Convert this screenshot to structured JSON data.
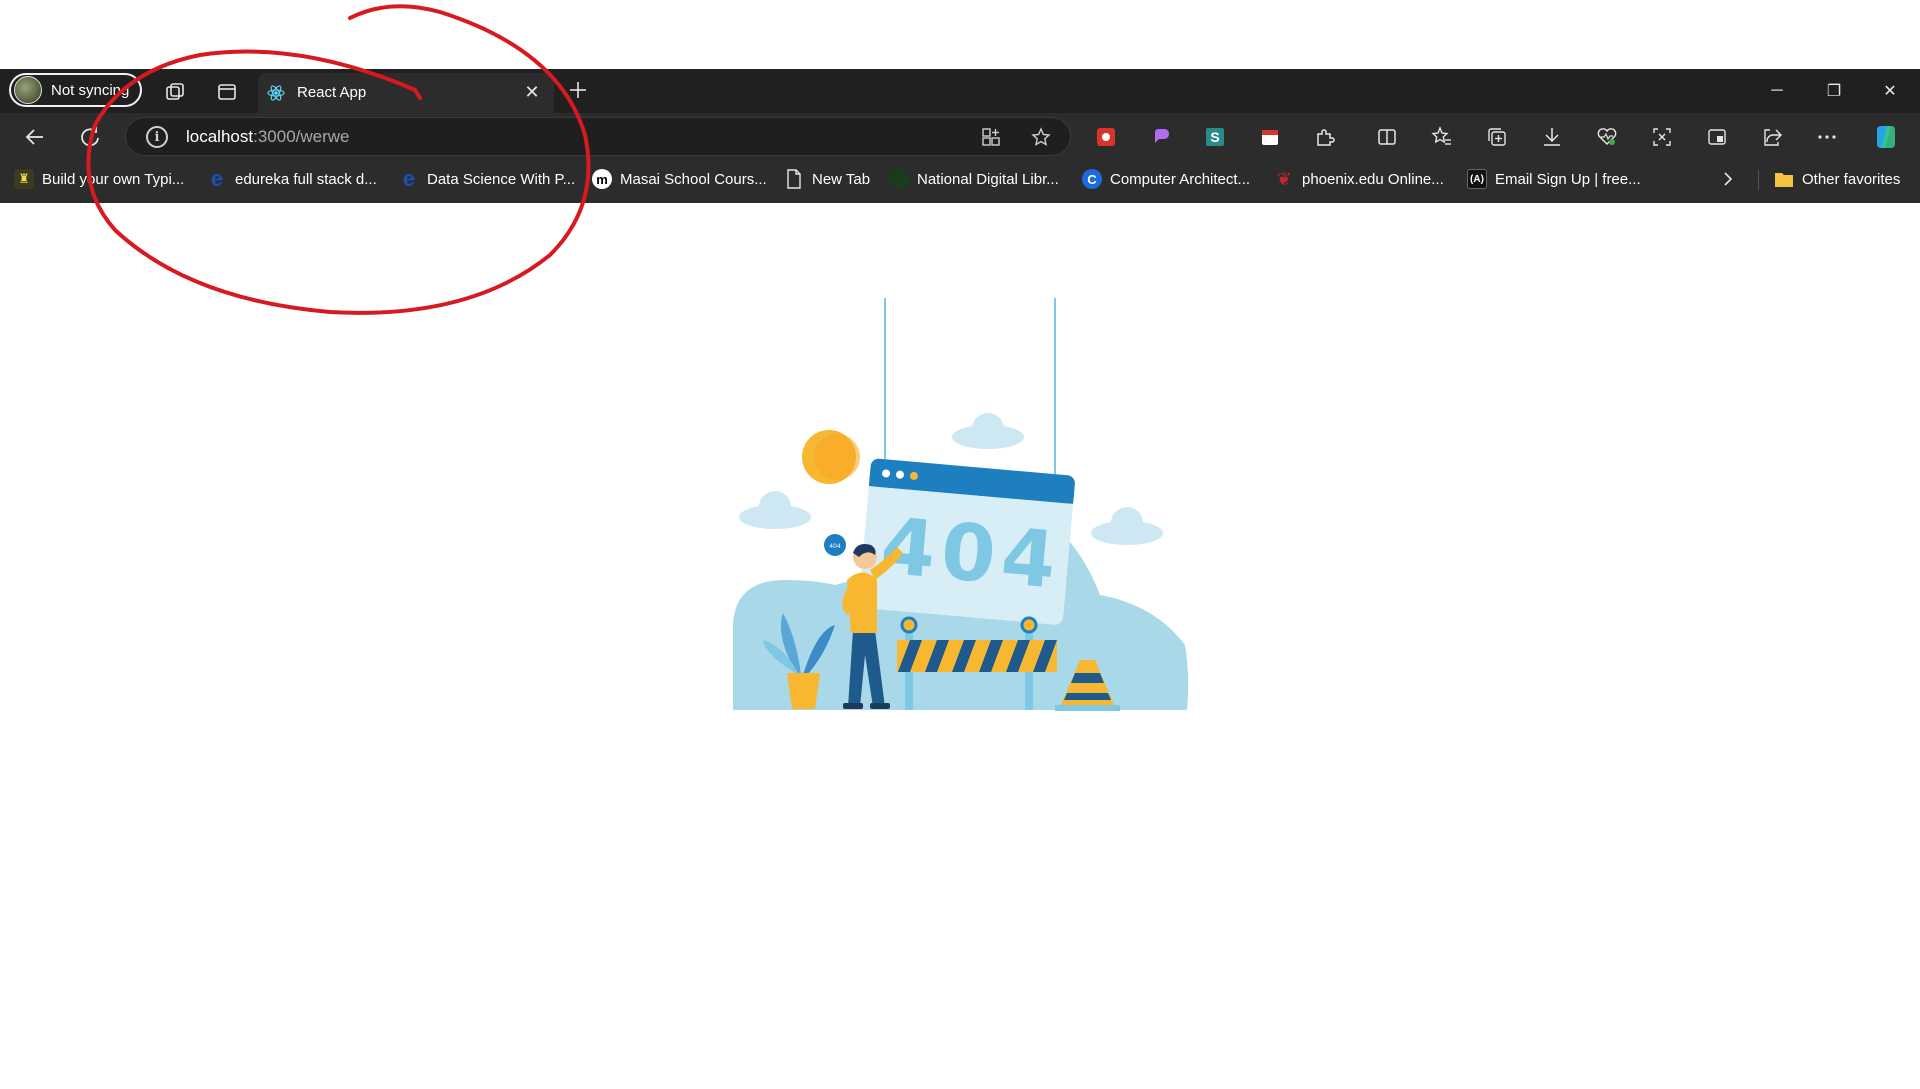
{
  "profile": {
    "label": "Not syncing"
  },
  "tab": {
    "title": "React App",
    "close_label": "✕"
  },
  "address": {
    "host": "localhost",
    "path": ":3000/werwe"
  },
  "window": {
    "minimize": "─",
    "restore": "❐",
    "close": "✕"
  },
  "favorites": {
    "items": [
      {
        "label": "Build your own Typi...",
        "icon": "typing-site-icon"
      },
      {
        "label": "edureka full stack d...",
        "icon": "edureka-icon"
      },
      {
        "label": "Data Science With P...",
        "icon": "edureka-icon"
      },
      {
        "label": "Masai School Cours...",
        "icon": "masai-icon"
      },
      {
        "label": "New Tab",
        "icon": "page-icon"
      },
      {
        "label": "National Digital Libr...",
        "icon": "ndl-icon"
      },
      {
        "label": "Computer Architect...",
        "icon": "c-logo-icon"
      },
      {
        "label": "phoenix.edu Online...",
        "icon": "phoenix-icon"
      },
      {
        "label": "Email Sign Up | free...",
        "icon": "email-signup-icon"
      }
    ],
    "other_label": "Other favorites"
  },
  "illustration": {
    "error_code": "404",
    "bubble": "404"
  },
  "colors": {
    "tabstrip": "#202020",
    "toolbar": "#2c2c2c",
    "annotation": "#d71920",
    "illus_blue": "#a9d8e8",
    "illus_dark_blue": "#1e7fc0",
    "illus_yellow": "#f7b731"
  }
}
